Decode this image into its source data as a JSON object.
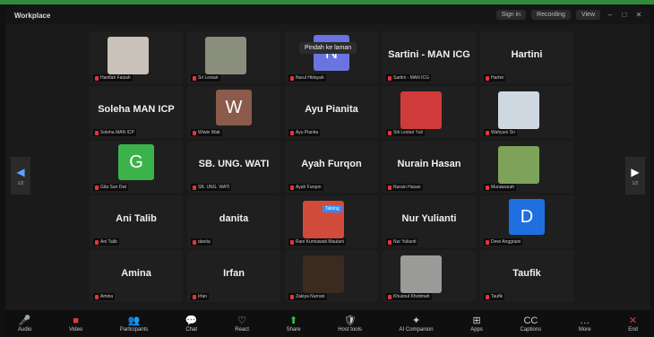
{
  "window": {
    "title": "Workplace"
  },
  "titlebar": {
    "pill1": "Sign in",
    "pill2": "Recording",
    "pill3": "View"
  },
  "tooltip": "Pindah ke laman",
  "colors": {
    "brand_bar": "#2e8b3a",
    "mic_muted": "#e23a3a",
    "share": "#2ecc40",
    "accent": "#2d8cff"
  },
  "speaker_badge": "Talking",
  "nav": {
    "left_label": "1/2",
    "right_label": "1/2"
  },
  "participants": [
    {
      "name": "",
      "label": "Hanifah Faizah",
      "kind": "photo",
      "color": "#c9c2b8"
    },
    {
      "name": "",
      "label": "Sri Lestari",
      "kind": "photo",
      "color": "#8a8f7c"
    },
    {
      "name": "N",
      "label": "Nurul Hidayah",
      "kind": "avatar",
      "color": "#6a74e0"
    },
    {
      "name": "Sartini - MAN ICG",
      "label": "Sartini - MAN ICG",
      "kind": "text"
    },
    {
      "name": "Hartini",
      "label": "Hartini",
      "kind": "text"
    },
    {
      "name": "Soleha MAN ICP",
      "label": "Soleha MAN ICP",
      "kind": "text"
    },
    {
      "name": "W",
      "label": "Wiwin Wati",
      "kind": "avatar",
      "color": "#8b5a4a"
    },
    {
      "name": "Ayu Pianita",
      "label": "Ayu Pianita",
      "kind": "text"
    },
    {
      "name": "",
      "label": "Siti Lestari Yuli",
      "kind": "photo",
      "color": "#d13a3a"
    },
    {
      "name": "",
      "label": "Wahyuni Sri",
      "kind": "photo",
      "color": "#cfd8e0"
    },
    {
      "name": "G",
      "label": "Gita Sari Dwi",
      "kind": "avatar",
      "color": "#3bb34a"
    },
    {
      "name": "SB. UNG. WATI",
      "label": "SB. UNG. WATI",
      "kind": "text"
    },
    {
      "name": "Ayah Furqon",
      "label": "Ayah Furqon",
      "kind": "text"
    },
    {
      "name": "Nurain Hasan",
      "label": "Nurain Hasan",
      "kind": "text"
    },
    {
      "name": "",
      "label": "Munawarah",
      "kind": "photo",
      "color": "#7da35b"
    },
    {
      "name": "Ani Talib",
      "label": "Ani Talib",
      "kind": "text"
    },
    {
      "name": "danita",
      "label": "danita",
      "kind": "text"
    },
    {
      "name": "",
      "label": "Rani Kurniawati Maulani",
      "kind": "photo",
      "color": "#d24a3a"
    },
    {
      "name": "Nur Yulianti",
      "label": "Nur Yulianti",
      "kind": "text"
    },
    {
      "name": "D",
      "label": "Dewi Anggraini",
      "kind": "avatar",
      "color": "#1f6fe0"
    },
    {
      "name": "Amina",
      "label": "Amina",
      "kind": "text"
    },
    {
      "name": "Irfan",
      "label": "Irfan",
      "kind": "text"
    },
    {
      "name": "",
      "label": "Zakiya Nurrani",
      "kind": "photo",
      "color": "#3b2a20"
    },
    {
      "name": "",
      "label": "Khusnul Khotimah",
      "kind": "photo",
      "color": "#9a9a98"
    },
    {
      "name": "Taufik",
      "label": "Taufik",
      "kind": "text"
    }
  ],
  "toolbar": [
    {
      "icon": "mic-icon",
      "glyph": "🎤",
      "label": "Audio",
      "style": "red"
    },
    {
      "icon": "camera-icon",
      "glyph": "■",
      "label": "Video",
      "style": "red"
    },
    {
      "icon": "participants-icon",
      "glyph": "👥",
      "label": "Participants",
      "style": ""
    },
    {
      "icon": "chat-icon",
      "glyph": "💬",
      "label": "Chat",
      "style": ""
    },
    {
      "icon": "react-icon",
      "glyph": "♡",
      "label": "React",
      "style": ""
    },
    {
      "icon": "share-icon",
      "glyph": "⬆",
      "label": "Share",
      "style": "share"
    },
    {
      "icon": "host-tools-icon",
      "glyph": "🛡",
      "label": "Host tools",
      "style": ""
    },
    {
      "icon": "ai-companion-icon",
      "glyph": "✦",
      "label": "AI Companion",
      "style": ""
    },
    {
      "icon": "apps-icon",
      "glyph": "⊞",
      "label": "Apps",
      "style": ""
    },
    {
      "icon": "captions-icon",
      "glyph": "CC",
      "label": "Captions",
      "style": ""
    },
    {
      "icon": "more-icon",
      "glyph": "…",
      "label": "More",
      "style": ""
    },
    {
      "icon": "end-icon",
      "glyph": "✕",
      "label": "End",
      "style": "red"
    }
  ]
}
